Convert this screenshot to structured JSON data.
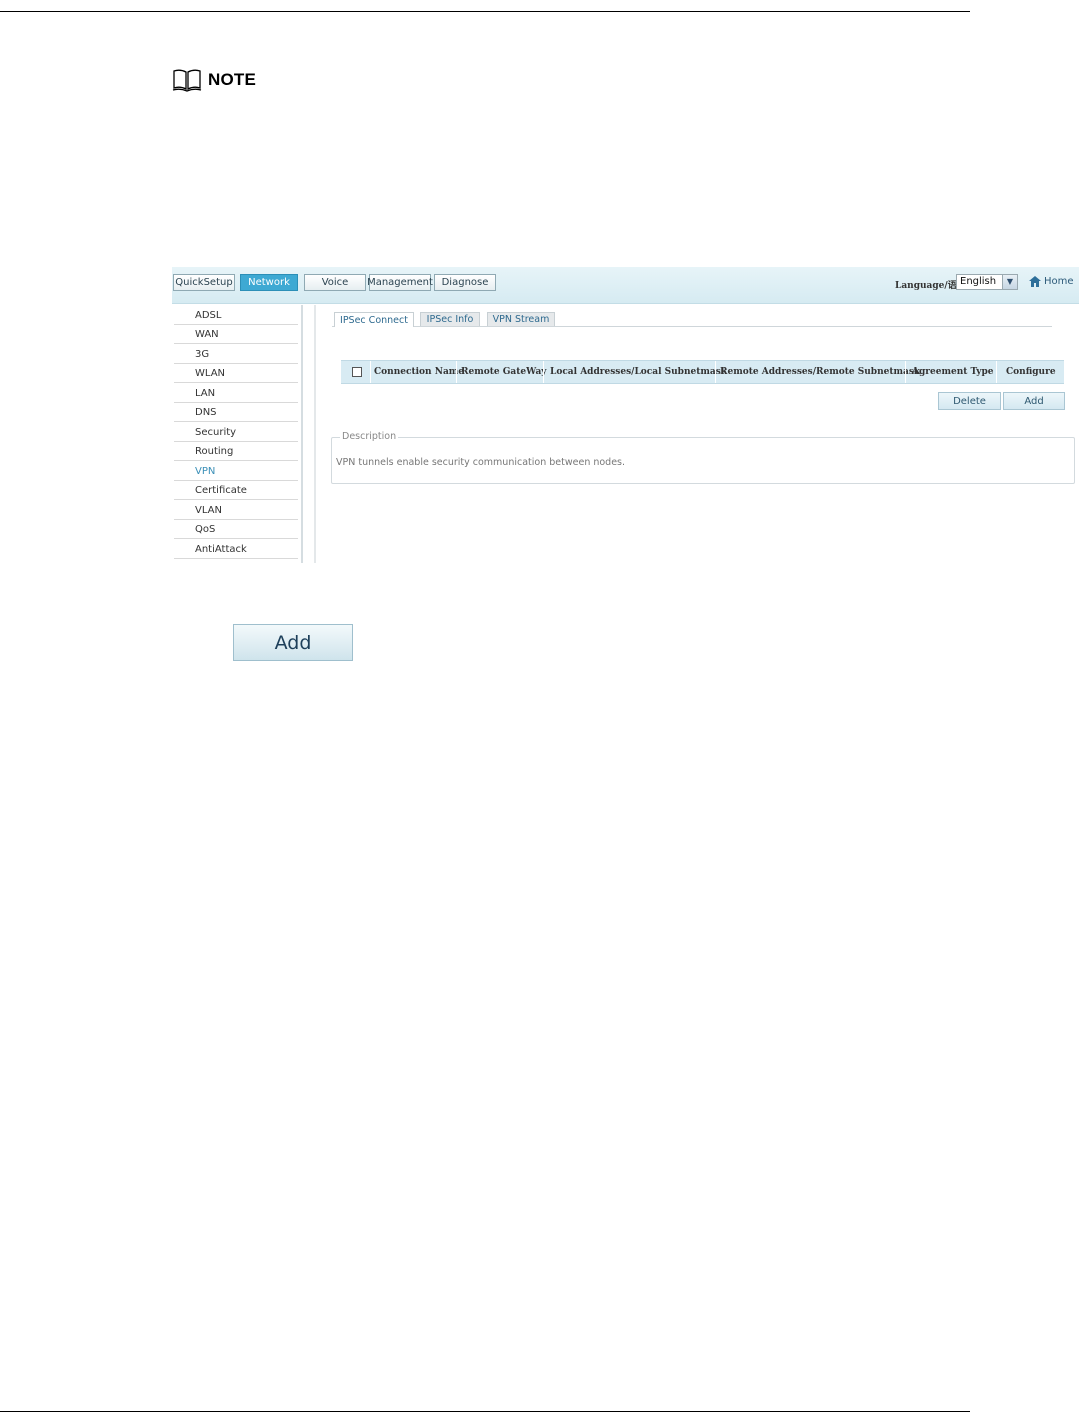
{
  "note": {
    "label": "NOTE"
  },
  "nav": {
    "items": [
      "QuickSetup",
      "Network",
      "Voice",
      "Management",
      "Diagnose"
    ],
    "active": "Network"
  },
  "language": {
    "label": "Language/语言:",
    "selected": "English"
  },
  "home": {
    "label": "Home"
  },
  "sidebar": {
    "items": [
      "ADSL",
      "WAN",
      "3G",
      "WLAN",
      "LAN",
      "DNS",
      "Security",
      "Routing",
      "VPN",
      "Certificate",
      "VLAN",
      "QoS",
      "AntiAttack"
    ],
    "active": "VPN"
  },
  "tabs": {
    "items": [
      "IPSec Connect",
      "IPSec Info",
      "VPN Stream"
    ],
    "active": "IPSec Connect"
  },
  "table": {
    "headers": [
      "Connection Name",
      "Remote GateWay",
      "Local Addresses/Local Subnetmask",
      "Remote Addresses/Remote Subnetmask",
      "Agreement Type",
      "Configure"
    ]
  },
  "actions": {
    "delete": "Delete",
    "add": "Add"
  },
  "description": {
    "legend": "Description",
    "text": "VPN tunnels enable security communication between nodes."
  },
  "big_add_button": {
    "label": "Add"
  },
  "colors": {
    "accent": "#3ea9d3",
    "header_bg": "#d8ebf3",
    "link": "#2e6a8f"
  }
}
